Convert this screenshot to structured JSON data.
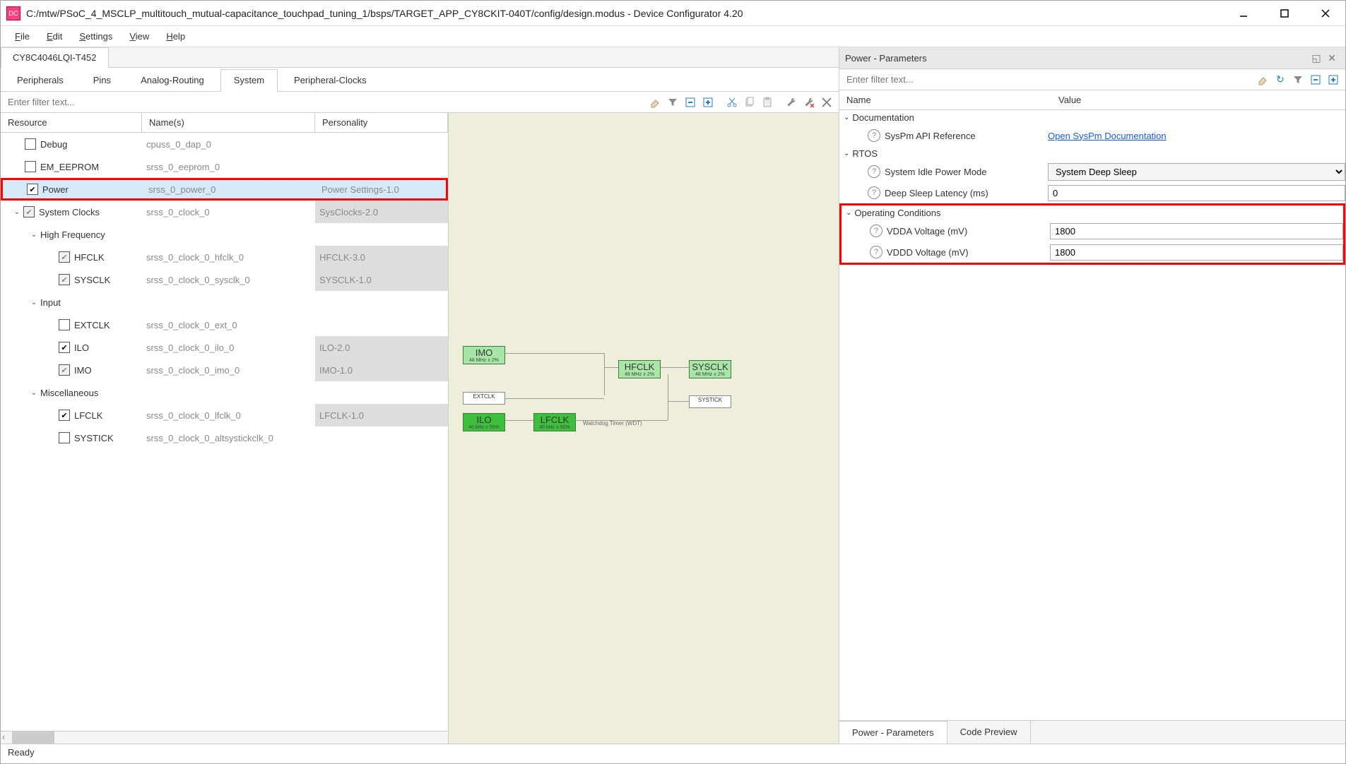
{
  "window": {
    "title": "C:/mtw/PSoC_4_MSCLP_multitouch_mutual-capacitance_touchpad_tuning_1/bsps/TARGET_APP_CY8CKIT-040T/config/design.modus - Device Configurator 4.20"
  },
  "menu": {
    "file": "File",
    "edit": "Edit",
    "settings": "Settings",
    "view": "View",
    "help": "Help"
  },
  "device_tab": "CY8C4046LQI-T452",
  "tabs": {
    "peripherals": "Peripherals",
    "pins": "Pins",
    "analog": "Analog-Routing",
    "system": "System",
    "pclocks": "Peripheral-Clocks"
  },
  "filter_placeholder": "Enter filter text...",
  "tree": {
    "headers": {
      "resource": "Resource",
      "names": "Name(s)",
      "personality": "Personality"
    },
    "rows": {
      "debug": {
        "label": "Debug",
        "name": "cpuss_0_dap_0"
      },
      "eeprom": {
        "label": "EM_EEPROM",
        "name": "srss_0_eeprom_0"
      },
      "power": {
        "label": "Power",
        "name": "srss_0_power_0",
        "pers": "Power Settings-1.0"
      },
      "sysclk": {
        "label": "System Clocks",
        "name": "srss_0_clock_0",
        "pers": "SysClocks-2.0"
      },
      "hfgroup": {
        "label": "High Frequency"
      },
      "hfclk": {
        "label": "HFCLK",
        "name": "srss_0_clock_0_hfclk_0",
        "pers": "HFCLK-3.0"
      },
      "sysclk2": {
        "label": "SYSCLK",
        "name": "srss_0_clock_0_sysclk_0",
        "pers": "SYSCLK-1.0"
      },
      "inpgroup": {
        "label": "Input"
      },
      "extclk": {
        "label": "EXTCLK",
        "name": "srss_0_clock_0_ext_0"
      },
      "ilo": {
        "label": "ILO",
        "name": "srss_0_clock_0_ilo_0",
        "pers": "ILO-2.0"
      },
      "imo": {
        "label": "IMO",
        "name": "srss_0_clock_0_imo_0",
        "pers": "IMO-1.0"
      },
      "miscgroup": {
        "label": "Miscellaneous"
      },
      "lfclk": {
        "label": "LFCLK",
        "name": "srss_0_clock_0_lfclk_0",
        "pers": "LFCLK-1.0"
      },
      "systick": {
        "label": "SYSTICK",
        "name": "srss_0_clock_0_altsystickclk_0"
      }
    }
  },
  "diagram": {
    "imo": "IMO",
    "imo_sub": "48 MHz ± 2%",
    "extclk": "EXTCLK",
    "ilo": "ILO",
    "ilo_sub": "40 kHz ± 50%",
    "lfclk": "LFCLK",
    "lfclk_sub": "40 kHz ± 50%",
    "hfclk": "HFCLK",
    "hfclk_sub": "48 MHz ± 2%",
    "sysclk": "SYSCLK",
    "sysclk_sub": "48 MHz ± 2%",
    "systick": "SYSTICK",
    "wdt": "Watchdog Timer (WDT)"
  },
  "right": {
    "title": "Power - Parameters",
    "filter_placeholder": "Enter filter text...",
    "headers": {
      "name": "Name",
      "value": "Value"
    },
    "groups": {
      "doc": {
        "title": "Documentation",
        "api_ref": "SysPm API Reference",
        "api_link": "Open SysPm Documentation"
      },
      "rtos": {
        "title": "RTOS",
        "idle_label": "System Idle Power Mode",
        "idle_val": "System Deep Sleep",
        "latency_label": "Deep Sleep Latency (ms)",
        "latency_val": "0"
      },
      "op": {
        "title": "Operating Conditions",
        "vdda_label": "VDDA Voltage (mV)",
        "vdda_val": "1800",
        "vddd_label": "VDDD Voltage (mV)",
        "vddd_val": "1800"
      }
    },
    "bottom_tabs": {
      "params": "Power - Parameters",
      "code": "Code Preview"
    }
  },
  "status": "Ready"
}
